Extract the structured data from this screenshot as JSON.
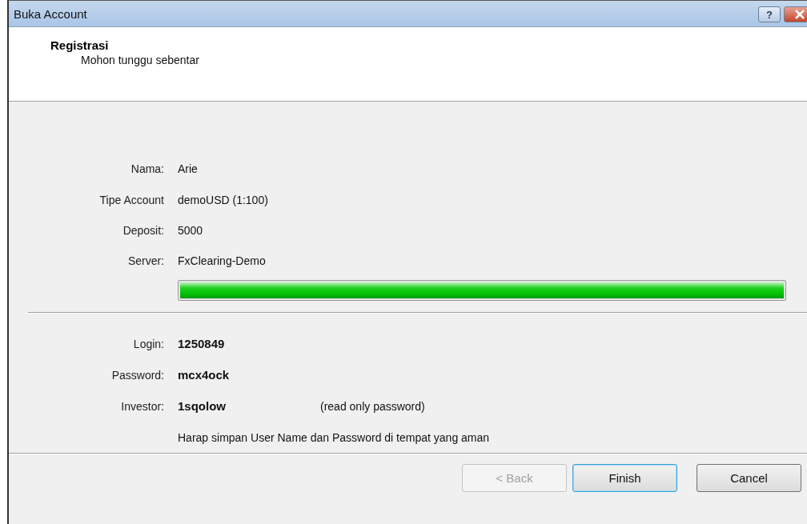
{
  "window": {
    "title": "Buka Account",
    "help": "?"
  },
  "header": {
    "title": "Registrasi",
    "subtitle": "Mohon tunggu sebentar"
  },
  "account_fields": [
    {
      "label": "Nama:",
      "value": "Arie"
    },
    {
      "label": "Tipe Account",
      "value": "demoUSD (1:100)"
    },
    {
      "label": "Deposit:",
      "value": "5000"
    },
    {
      "label": "Server:",
      "value": "FxClearing-Demo"
    }
  ],
  "progress": {
    "level": 1
  },
  "credentials": [
    {
      "label": "Login:",
      "value": "1250849"
    },
    {
      "label": "Password:",
      "value": "mcx4ock"
    },
    {
      "label": "Investor:",
      "value": "1sqolow",
      "note": "(read only password)"
    }
  ],
  "notice": "Harap simpan User Name dan Password di tempat yang aman",
  "buttons": [
    {
      "label": "< Back",
      "disabled": true,
      "default": false
    },
    {
      "label": "Finish",
      "disabled": false,
      "default": true
    },
    {
      "label": "Cancel",
      "disabled": false,
      "default": false
    }
  ]
}
